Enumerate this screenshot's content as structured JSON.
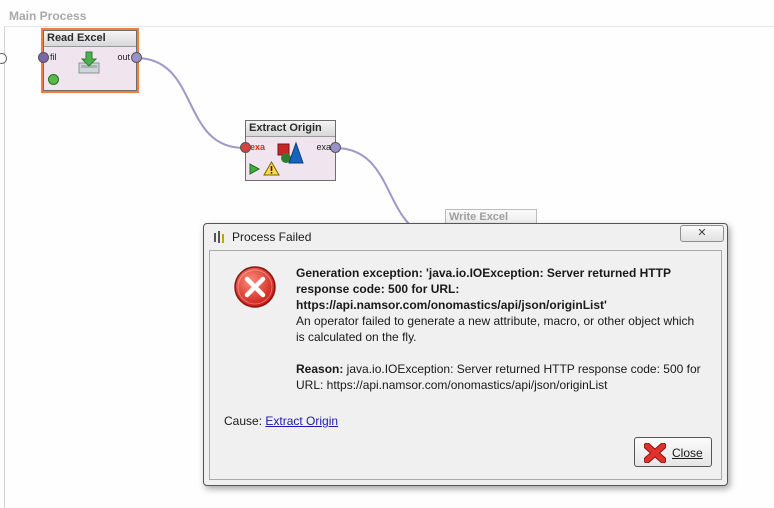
{
  "canvas": {
    "title": "Main Process"
  },
  "operators": {
    "read_excel": {
      "title": "Read Excel",
      "in_port": "fil",
      "out_port": "out"
    },
    "extract_origin": {
      "title": "Extract Origin",
      "in_port": "exa",
      "out_port": "exa"
    },
    "write_excel": {
      "title": "Write Excel"
    }
  },
  "dialog": {
    "title": "Process Failed",
    "heading": "Generation exception: 'java.io.IOException: Server returned HTTP response code: 500 for URL: https://api.namsor.com/onomastics/api/json/originList'",
    "description": "An operator failed to generate a new attribute, macro, or other object which is calculated on the fly.",
    "reason_label": "Reason:",
    "reason_text": " java.io.IOException: Server returned HTTP response code: 500 for URL: https://api.namsor.com/onomastics/api/json/originList",
    "cause_label": "Cause: ",
    "cause_link": "Extract Origin",
    "close_label": "Close"
  },
  "icons": {
    "error": "error-x-icon",
    "close": "red-x-icon",
    "app": "rapidminer-icon",
    "warning": "warning-icon"
  },
  "colors": {
    "selected_outline": "#f07f3c",
    "error_red": "#e0312b",
    "link": "#1a1ab0"
  }
}
